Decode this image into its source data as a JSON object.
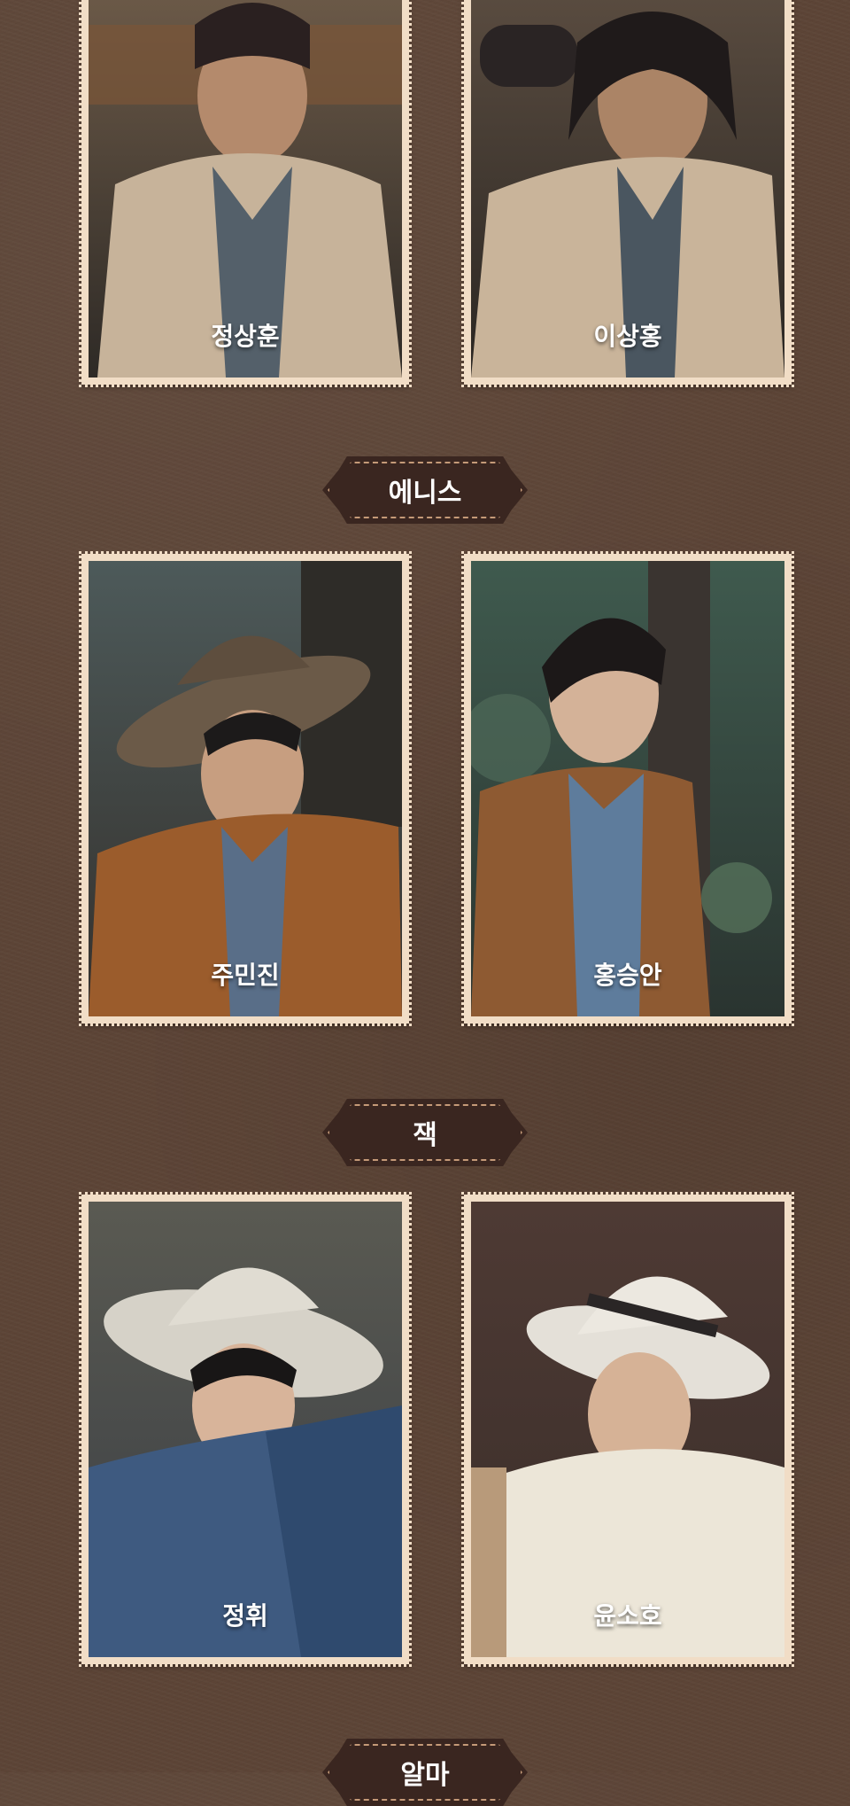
{
  "sections": [
    {
      "title": "",
      "members": [
        {
          "name": "정상훈"
        },
        {
          "name": "이상홍"
        }
      ]
    },
    {
      "title": "에니스",
      "members": [
        {
          "name": "주민진"
        },
        {
          "name": "홍승안"
        }
      ]
    },
    {
      "title": "잭",
      "members": [
        {
          "name": "정휘"
        },
        {
          "name": "윤소호"
        }
      ]
    },
    {
      "title": "알마",
      "members": []
    }
  ],
  "colors": {
    "background": "#5c4436",
    "card_frame": "#f1ddc6",
    "banner": "#3a2620",
    "banner_stitch": "#c59a78"
  }
}
